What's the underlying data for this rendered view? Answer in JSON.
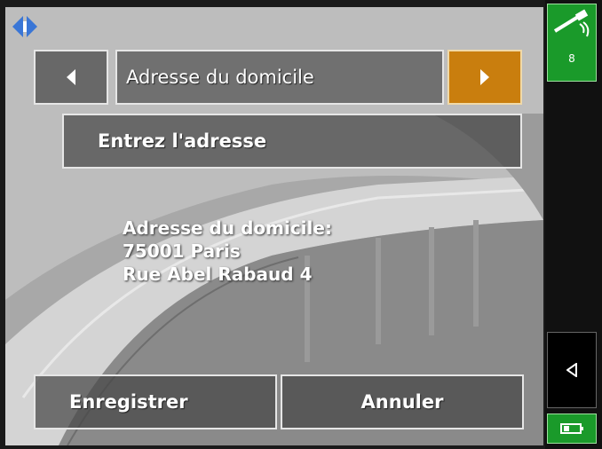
{
  "header": {
    "field_label": "Adresse du domicile"
  },
  "buttons": {
    "enter_address": "Entrez l'adresse",
    "save": "Enregistrer",
    "cancel": "Annuler"
  },
  "address": {
    "heading": "Adresse du domicile:",
    "line1": "75001 Paris",
    "line2": "Rue Abel Rabaud 4"
  },
  "status": {
    "gps_satellites": "8"
  },
  "icons": [
    "compass-logo-icon",
    "arrow-left-icon",
    "arrow-right-icon",
    "satellite-icon",
    "back-arrow-icon",
    "battery-icon"
  ],
  "colors": {
    "accent_orange": "#c97e0e",
    "status_green": "#1a9a2a"
  }
}
